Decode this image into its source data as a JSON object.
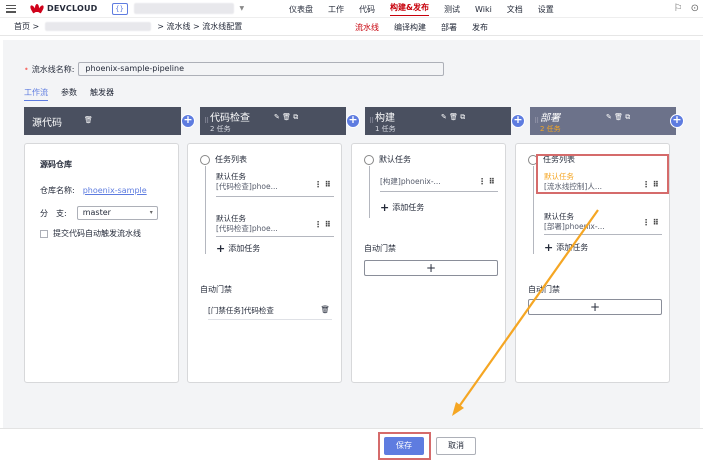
{
  "topbar": {
    "logo": "DEVCLOUD",
    "project_icon": "{}",
    "nav": [
      "仪表盘",
      "工作",
      "代码",
      "构建&发布",
      "测试",
      "Wiki",
      "文档",
      "设置"
    ],
    "nav_active": "构建&发布"
  },
  "breadcrumb": {
    "home": "首页 >",
    "path": "> 流水线 > 流水线配置"
  },
  "subnav": [
    "流水线",
    "编译构建",
    "部署",
    "发布"
  ],
  "name_field": {
    "label": "流水线名称:",
    "value": "phoenix-sample-pipeline"
  },
  "tabs": [
    "工作流",
    "参数",
    "触发器"
  ],
  "stages": [
    {
      "name": "源代码",
      "count": ""
    },
    {
      "name": "代码检查",
      "count": "2 任务"
    },
    {
      "name": "构建",
      "count": "1 任务"
    },
    {
      "name": "部署",
      "count": "2 任务"
    }
  ],
  "source": {
    "title": "源码仓库",
    "repo_label": "仓库名称:",
    "repo_value": "phoenix-sample",
    "branch_label": "分　支:",
    "branch_value": "master",
    "auto_trigger": "提交代码自动触发流水线"
  },
  "col_check": {
    "header": "任务列表",
    "task1_title": "默认任务",
    "task1_sub": "[代码检查]phoe...",
    "task2_title": "默认任务",
    "task2_sub": "[代码检查]phoe...",
    "add_task": "添加任务",
    "gate_label": "自动门禁",
    "gate_item": "[门禁任务]代码检查"
  },
  "col_build": {
    "header": "默认任务",
    "task1_sub": "[构建]phoenix-...",
    "add_task": "添加任务",
    "gate_label": "自动门禁"
  },
  "col_deploy": {
    "header": "任务列表",
    "task1_title": "默认任务",
    "task1_sub": "[流水线控制]人...",
    "task2_title": "默认任务",
    "task2_sub": "[部署]phoenix-...",
    "add_task": "添加任务",
    "gate_label": "自动门禁"
  },
  "footer": {
    "save": "保存",
    "cancel": "取消"
  },
  "colors": {
    "accent": "#5e7ce0",
    "brand": "#c7000b",
    "highlight": "#d56b6b",
    "annotation": "#f5a623"
  }
}
